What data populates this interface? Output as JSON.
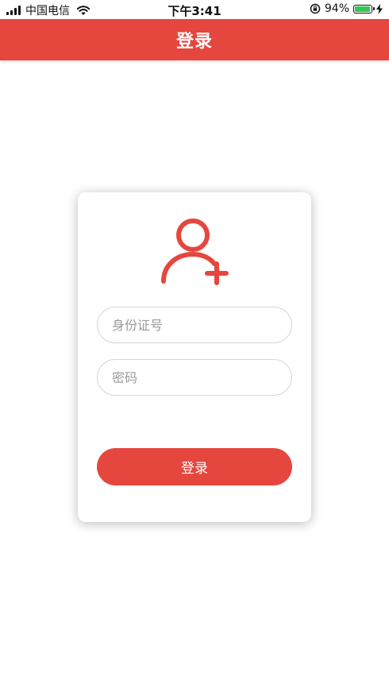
{
  "status_bar": {
    "carrier": "中国电信",
    "time": "下午3:41",
    "battery": "94%",
    "battery_level": 0.94
  },
  "nav": {
    "title": "登录"
  },
  "form": {
    "id_placeholder": "身份证号",
    "id_value": "",
    "password_placeholder": "密码",
    "password_value": "",
    "login_label": "登录"
  },
  "icons": {
    "avatar": "user-add-icon"
  },
  "colors": {
    "accent": "#e5463d",
    "battery": "#34c759",
    "input_border": "#d6d6d6"
  }
}
